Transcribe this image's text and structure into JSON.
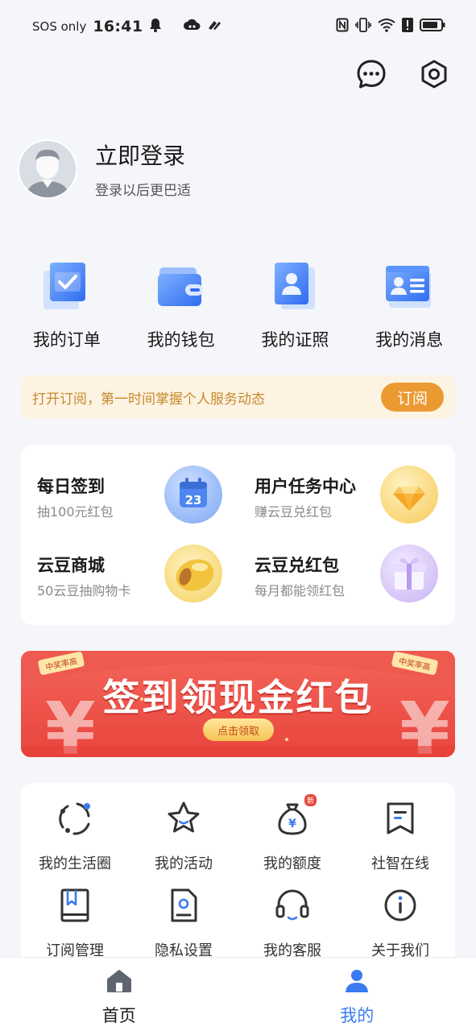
{
  "status_bar": {
    "carrier": "SOS only",
    "time": "16:41",
    "icons": [
      "bell-icon",
      "cloud-icon",
      "link-icon",
      "nfc-icon",
      "vibrate-icon",
      "wifi-icon",
      "alert-icon",
      "battery-icon"
    ]
  },
  "header": {
    "icons": [
      "message-icon",
      "settings-icon"
    ]
  },
  "profile": {
    "title": "立即登录",
    "subtitle": "登录以后更巴适"
  },
  "quick_links": [
    {
      "label": "我的订单",
      "icon": "order-icon"
    },
    {
      "label": "我的钱包",
      "icon": "wallet-icon"
    },
    {
      "label": "我的证照",
      "icon": "certificate-icon"
    },
    {
      "label": "我的消息",
      "icon": "message-card-icon"
    }
  ],
  "subscribe": {
    "text": "打开订阅，第一时间掌握个人服务动态",
    "button": "订阅"
  },
  "tasks": [
    {
      "title": "每日签到",
      "subtitle": "抽100元红包",
      "icon": "calendar-icon",
      "date": "23"
    },
    {
      "title": "用户任务中心",
      "subtitle": "赚云豆兑红包",
      "icon": "diamond-icon"
    },
    {
      "title": "云豆商城",
      "subtitle": "50云豆抽购物卡",
      "icon": "bean-icon"
    },
    {
      "title": "云豆兑红包",
      "subtitle": "每月都能领红包",
      "icon": "gift-icon"
    }
  ],
  "promo_banner": {
    "title": "签到领现金红包",
    "button": "点击领取",
    "tag": "中奖率高"
  },
  "services": [
    {
      "label": "我的生活圈",
      "icon": "life-circle-icon"
    },
    {
      "label": "我的活动",
      "icon": "star-icon"
    },
    {
      "label": "我的额度",
      "icon": "money-bag-icon",
      "badge": "新"
    },
    {
      "label": "社智在线",
      "icon": "document-icon"
    },
    {
      "label": "订阅管理",
      "icon": "bookmark-book-icon"
    },
    {
      "label": "隐私设置",
      "icon": "privacy-icon"
    },
    {
      "label": "我的客服",
      "icon": "headset-icon"
    },
    {
      "label": "关于我们",
      "icon": "info-icon"
    }
  ],
  "bottom_nav": [
    {
      "label": "首页",
      "icon": "home-icon",
      "active": false
    },
    {
      "label": "我的",
      "icon": "user-icon",
      "active": true
    }
  ],
  "colors": {
    "accent_blue": "#3a7bf0",
    "subscribe_orange": "#eb9a32",
    "promo_red": "#e8453d"
  }
}
